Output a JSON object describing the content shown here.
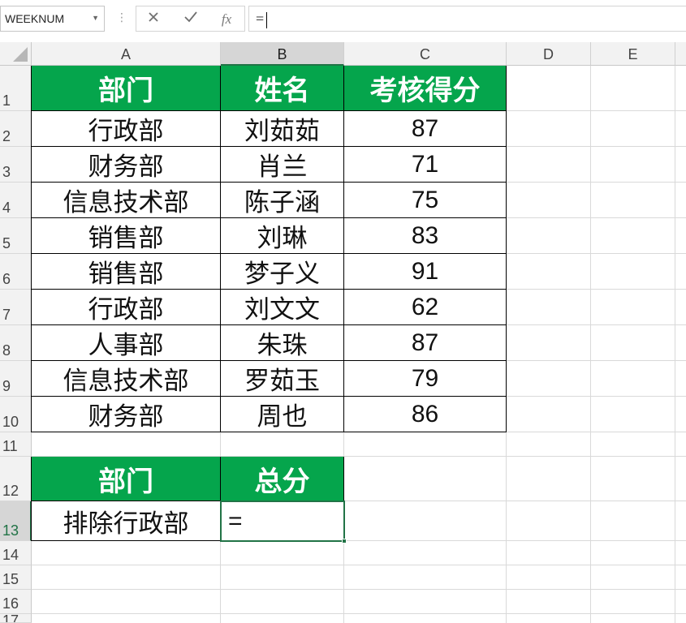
{
  "name_box": {
    "value": "WEEKNUM"
  },
  "formula_bar": {
    "value": "="
  },
  "columns": [
    "A",
    "B",
    "C",
    "D",
    "E"
  ],
  "rows": [
    "1",
    "2",
    "3",
    "4",
    "5",
    "6",
    "7",
    "8",
    "9",
    "10",
    "11",
    "12",
    "13",
    "14",
    "15",
    "16",
    "17"
  ],
  "table1": {
    "headers": [
      "部门",
      "姓名",
      "考核得分"
    ],
    "rows": [
      [
        "行政部",
        "刘茹茹",
        "87"
      ],
      [
        "财务部",
        "肖兰",
        "71"
      ],
      [
        "信息技术部",
        "陈子涵",
        "75"
      ],
      [
        "销售部",
        "刘琳",
        "83"
      ],
      [
        "销售部",
        "梦子义",
        "91"
      ],
      [
        "行政部",
        "刘文文",
        "62"
      ],
      [
        "人事部",
        "朱珠",
        "87"
      ],
      [
        "信息技术部",
        "罗茹玉",
        "79"
      ],
      [
        "财务部",
        "周也",
        "86"
      ]
    ]
  },
  "table2": {
    "headers": [
      "部门",
      "总分"
    ],
    "row": [
      "排除行政部",
      "="
    ]
  },
  "colors": {
    "header_fill": "#05a54c",
    "header_text": "#ffffff",
    "selection": "#217346"
  }
}
